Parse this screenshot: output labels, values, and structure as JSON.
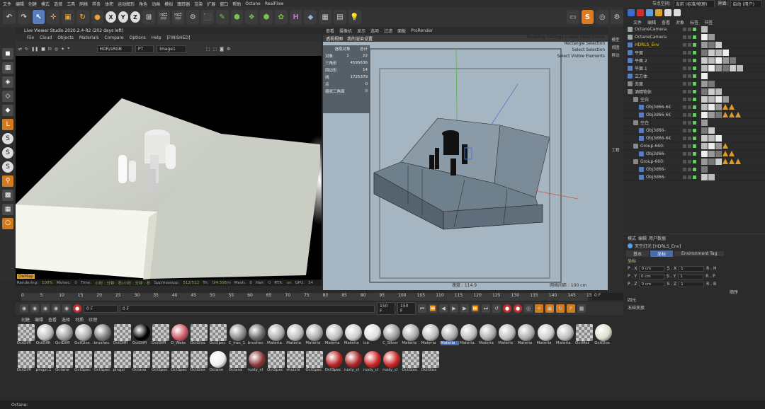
{
  "menubar": {
    "items": [
      "文件",
      "编辑",
      "创建",
      "模式",
      "选择",
      "工具",
      "网格",
      "样条",
      "体积",
      "运动图形",
      "角色",
      "动画",
      "模拟",
      "跟踪器",
      "渲染",
      "扩展",
      "窗口",
      "帮助",
      "Octane",
      "RealFlow"
    ],
    "node_space_label": "节点空间:",
    "node_space_value": "当前 (标准/物理)",
    "interface_label": "界面:",
    "interface_value": "启动 (用户)"
  },
  "toolbar": {
    "xyz": [
      "X",
      "Y",
      "Z"
    ]
  },
  "live_viewer": {
    "title": "Live Viewer Studio 2020.2.4-R2 (202 days left)",
    "menu": [
      "File",
      "Cloud",
      "Objects",
      "Materials",
      "Compare",
      "Options",
      "Help",
      "[FINISHED]"
    ],
    "color_space": "HDR/sRGB",
    "kernel": "PT",
    "image": "Image1",
    "mode_label": "DeMap",
    "status": {
      "rendering_label": "Rendering:",
      "rendering": "100%",
      "mssec_label": "Ms/sec:",
      "mssec": "0",
      "time_label": "Time:",
      "time": "小时 : 分钟 : 秒/小时 : 分钟 : 秒",
      "spp_label": "Spp/maxspp:",
      "spp": "512/512",
      "tri_label": "Tri:",
      "tri": "0/4.595m",
      "mesh_label": "Mesh:",
      "mesh": "8",
      "hair_label": "Hair:",
      "hair": "0",
      "rtx_label": "RTX:",
      "rtx": "on",
      "gpu_label": "GPU:",
      "gpu": "54"
    }
  },
  "viewport": {
    "menu": [
      "查看",
      "摄像机",
      "显示",
      "选项",
      "过滤",
      "面板",
      "ProRender"
    ],
    "sub": [
      "透视视图",
      "我的渲染设置"
    ],
    "stats_header": [
      "选取对象",
      "总计"
    ],
    "stats": [
      {
        "k": "对象",
        "a": "1",
        "b": "22"
      },
      {
        "k": "三角形",
        "a": "",
        "b": "4595636"
      },
      {
        "k": "四边形",
        "a": "",
        "b": "14"
      },
      {
        "k": "线",
        "a": "",
        "b": "1725379"
      },
      {
        "k": "点",
        "a": "",
        "b": "0"
      },
      {
        "k": "缩状三角面",
        "a": "",
        "b": "0"
      }
    ],
    "info": [
      "Modeling Settings Enable Mesh Check",
      "Rectangle Selection",
      "Select Selection",
      "Select Visible Elements"
    ],
    "speed": "速度 : 114.9",
    "grid": "网格间距 : 100 cm"
  },
  "right_strip": [
    "模型",
    "视图",
    "移动",
    "工程"
  ],
  "object_manager": {
    "menu": [
      "文件",
      "编辑",
      "查看",
      "对象",
      "标签",
      "书签"
    ],
    "objects": [
      {
        "name": "OctaneCamera",
        "color": "#9aa"
      },
      {
        "name": "OctaneCamera",
        "color": "#9aa"
      },
      {
        "name": "HDRLS_Env",
        "color": "#5a7dbf",
        "highlight": true
      },
      {
        "name": "平面",
        "color": "#5a7dbf"
      },
      {
        "name": "平面.2",
        "color": "#5a7dbf"
      },
      {
        "name": "平面.1",
        "color": "#5a7dbf"
      },
      {
        "name": "立方体",
        "color": "#5a7dbf"
      },
      {
        "name": "去面",
        "color": "#888"
      },
      {
        "name": "酒精物体",
        "color": "#888"
      },
      {
        "name": "空白",
        "color": "#888"
      },
      {
        "name": "Obj3d66-6€",
        "color": "#5a7dbf"
      },
      {
        "name": "Obj3d66-6€",
        "color": "#5a7dbf"
      },
      {
        "name": "空白",
        "color": "#888"
      },
      {
        "name": "Obj3d66-",
        "color": "#5a7dbf"
      },
      {
        "name": "Obj3d66-6€",
        "color": "#5a7dbf"
      },
      {
        "name": "Group-660:",
        "color": "#888"
      },
      {
        "name": "Obj3d66-",
        "color": "#5a7dbf"
      },
      {
        "name": "Group-660:",
        "color": "#888"
      },
      {
        "name": "Obj3d66-",
        "color": "#5a7dbf"
      },
      {
        "name": "Obj3d66-",
        "color": "#5a7dbf"
      }
    ]
  },
  "attributes": {
    "menu": [
      "模式",
      "编辑",
      "用户数据"
    ],
    "object_title": "天空灯光 [HDRLS_Env]",
    "tabs": [
      "基本",
      "坐标",
      "Environment Tag"
    ],
    "active_tab": "坐标",
    "section": "坐标",
    "rows": [
      {
        "a": "P . X",
        "av": "0 cm",
        "b": "S . X",
        "bv": "1",
        "c": "R . H"
      },
      {
        "a": "P . Y",
        "av": "0 cm",
        "b": "S . Y",
        "bv": "1",
        "c": "R . P"
      },
      {
        "a": "P . Z",
        "av": "0 cm",
        "b": "S . Z",
        "bv": "1",
        "c": "R . B"
      }
    ],
    "order_label": "顺序",
    "groups": [
      "四元",
      "冻结变换"
    ]
  },
  "timeline": {
    "ticks": [
      "0",
      "5",
      "10",
      "15",
      "20",
      "25",
      "30",
      "35",
      "40",
      "45",
      "50",
      "55",
      "60",
      "65",
      "70",
      "75",
      "80",
      "85",
      "90",
      "95",
      "100",
      "105",
      "110",
      "115",
      "120",
      "125",
      "130",
      "135",
      "140",
      "145",
      "150"
    ],
    "end_frame": "0 F"
  },
  "transport": {
    "cur_a": "0 F",
    "cur_b": "0 F",
    "end_a": "150 F",
    "end_b": "150 F"
  },
  "material_menu": [
    "创建",
    "编辑",
    "查看",
    "选择",
    "材质",
    "纹理"
  ],
  "materials": [
    {
      "label": "OctDiffi",
      "c": "checker"
    },
    {
      "label": "OctDiffi",
      "c": "#bbb"
    },
    {
      "label": "OctDiffi",
      "c": "#999"
    },
    {
      "label": "OctGlos",
      "c": "#aaa"
    },
    {
      "label": "brushec",
      "c": "#777"
    },
    {
      "label": "OctDiffi",
      "c": "checker"
    },
    {
      "label": "OctDiffi",
      "c": "#000"
    },
    {
      "label": "OctDiffi",
      "c": "checker"
    },
    {
      "label": "D_Wate",
      "c": "#c56"
    },
    {
      "label": "OctGlos",
      "c": "checker"
    },
    {
      "label": "OctSpec",
      "c": "checker"
    },
    {
      "label": "C_iron_1",
      "c": "#888"
    },
    {
      "label": "brushec",
      "c": "#666"
    },
    {
      "label": "Materia",
      "c": "#aaa"
    },
    {
      "label": "Materia",
      "c": "#bbb"
    },
    {
      "label": "Materia",
      "c": "#aaa"
    },
    {
      "label": "Materia",
      "c": "#bbb"
    },
    {
      "label": "Materia",
      "c": "#ccc"
    },
    {
      "label": "Ice",
      "c": "#ddd"
    },
    {
      "label": "C_Silver",
      "c": "#999"
    },
    {
      "label": "Materia",
      "c": "#aaa"
    },
    {
      "label": "Materia",
      "c": "#bbb"
    },
    {
      "label": "Materia",
      "c": "#aaa",
      "active": true
    },
    {
      "label": "Materia",
      "c": "#bbb"
    },
    {
      "label": "Materia",
      "c": "#aaa"
    },
    {
      "label": "Materia",
      "c": "#bbb"
    },
    {
      "label": "Materia",
      "c": "#aaa"
    },
    {
      "label": "Materia",
      "c": "#ccc"
    },
    {
      "label": "Materia",
      "c": "#bbb"
    },
    {
      "label": "OctMet",
      "c": "checker"
    },
    {
      "label": "OctGlos",
      "c": "#ddc"
    },
    {
      "label": "OctDiffi",
      "c": "checker"
    },
    {
      "label": "pingzi.1",
      "c": "checker"
    },
    {
      "label": "Octane",
      "c": "checker"
    },
    {
      "label": "OctSpec",
      "c": "checker"
    },
    {
      "label": "OctSpec",
      "c": "checker"
    },
    {
      "label": "pingzi",
      "c": "checker"
    },
    {
      "label": "Octane",
      "c": "checker"
    },
    {
      "label": "OctSpec",
      "c": "checker"
    },
    {
      "label": "OctSpec",
      "c": "checker"
    },
    {
      "label": "OctGlos",
      "c": "checker"
    },
    {
      "label": "Octane",
      "c": "#eee"
    },
    {
      "label": "Octane",
      "c": "checker"
    },
    {
      "label": "rusty_cl",
      "c": "#833"
    },
    {
      "label": "OctSpec",
      "c": "checker"
    },
    {
      "label": "shuizhi",
      "c": "checker"
    },
    {
      "label": "OctSpec",
      "c": "checker"
    },
    {
      "label": "OctSpec",
      "c": "#b22"
    },
    {
      "label": "rusty_cl",
      "c": "#a22"
    },
    {
      "label": "rusty_cl",
      "c": "#c22"
    },
    {
      "label": "rusty_cl",
      "c": "#c22"
    },
    {
      "label": "OctGlos",
      "c": "checker"
    },
    {
      "label": "OctGlos",
      "c": "checker"
    }
  ],
  "status": "Octane:"
}
